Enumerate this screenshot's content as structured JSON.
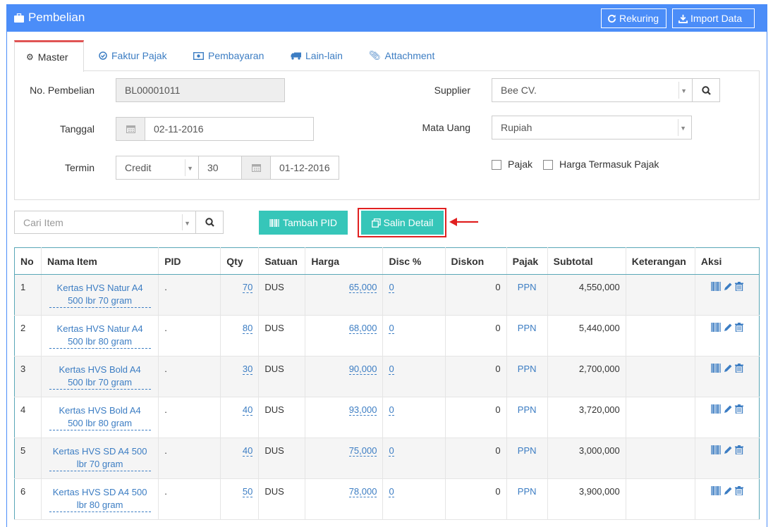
{
  "header": {
    "title": "Pembelian",
    "rekuring_label": "Rekuring",
    "import_label": "Import Data"
  },
  "tabs": [
    {
      "label": "Master",
      "icon": "cogs-icon"
    },
    {
      "label": "Faktur Pajak",
      "icon": "check-circle-icon"
    },
    {
      "label": "Pembayaran",
      "icon": "money-icon"
    },
    {
      "label": "Lain-lain",
      "icon": "truck-icon"
    },
    {
      "label": "Attachment",
      "icon": "paperclip-icon"
    }
  ],
  "form": {
    "no_pembelian_label": "No. Pembelian",
    "no_pembelian_value": "BL00001011",
    "tanggal_label": "Tanggal",
    "tanggal_value": "02-11-2016",
    "termin_label": "Termin",
    "termin_type": "Credit",
    "termin_days": "30",
    "termin_date": "01-12-2016",
    "supplier_label": "Supplier",
    "supplier_value": "Bee CV.",
    "mata_uang_label": "Mata Uang",
    "mata_uang_value": "Rupiah",
    "pajak_label": "Pajak",
    "pajak_checked": false,
    "harga_termasuk_pajak_label": "Harga Termasuk Pajak",
    "harga_termasuk_pajak_checked": false
  },
  "toolbar": {
    "cari_item_placeholder": "Cari Item",
    "tambah_pid_label": "Tambah PID",
    "salin_detail_label": "Salin Detail"
  },
  "table": {
    "columns": [
      "No",
      "Nama Item",
      "PID",
      "Qty",
      "Satuan",
      "Harga",
      "Disc %",
      "Diskon",
      "Pajak",
      "Subtotal",
      "Keterangan",
      "Aksi"
    ],
    "rows": [
      {
        "no": "1",
        "nama1": "Kertas HVS Natur A4",
        "nama2": "500 lbr 70 gram",
        "pid": ".",
        "qty": "70",
        "satuan": "DUS",
        "harga": "65,000",
        "disc": "0",
        "diskon": "0",
        "pajak": "PPN",
        "subtotal": "4,550,000",
        "keterangan": ""
      },
      {
        "no": "2",
        "nama1": "Kertas HVS Natur A4",
        "nama2": "500 lbr 80 gram",
        "pid": ".",
        "qty": "80",
        "satuan": "DUS",
        "harga": "68,000",
        "disc": "0",
        "diskon": "0",
        "pajak": "PPN",
        "subtotal": "5,440,000",
        "keterangan": ""
      },
      {
        "no": "3",
        "nama1": "Kertas HVS Bold A4",
        "nama2": "500 lbr 70 gram",
        "pid": ".",
        "qty": "30",
        "satuan": "DUS",
        "harga": "90,000",
        "disc": "0",
        "diskon": "0",
        "pajak": "PPN",
        "subtotal": "2,700,000",
        "keterangan": ""
      },
      {
        "no": "4",
        "nama1": "Kertas HVS Bold A4",
        "nama2": "500 lbr 80 gram",
        "pid": ".",
        "qty": "40",
        "satuan": "DUS",
        "harga": "93,000",
        "disc": "0",
        "diskon": "0",
        "pajak": "PPN",
        "subtotal": "3,720,000",
        "keterangan": ""
      },
      {
        "no": "5",
        "nama1": "Kertas HVS SD A4 500",
        "nama2": "lbr 70 gram",
        "pid": ".",
        "qty": "40",
        "satuan": "DUS",
        "harga": "75,000",
        "disc": "0",
        "diskon": "0",
        "pajak": "PPN",
        "subtotal": "3,000,000",
        "keterangan": ""
      },
      {
        "no": "6",
        "nama1": "Kertas HVS SD A4 500",
        "nama2": "lbr 80 gram",
        "pid": ".",
        "qty": "50",
        "satuan": "DUS",
        "harga": "78,000",
        "disc": "0",
        "diskon": "0",
        "pajak": "PPN",
        "subtotal": "3,900,000",
        "keterangan": ""
      }
    ]
  },
  "colors": {
    "header_blue": "#4b8df8",
    "teal_button": "#36c6b9",
    "highlight_red": "#e02020",
    "link_blue": "#3c7dc3",
    "active_tab_border": "#e05454"
  }
}
